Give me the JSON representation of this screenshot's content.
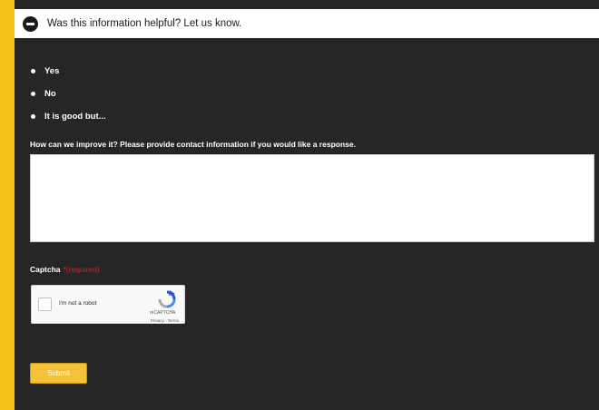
{
  "header": {
    "title": "Was this information helpful? Let us know."
  },
  "options": [
    {
      "label": "Yes"
    },
    {
      "label": "No"
    },
    {
      "label": "It is good but..."
    }
  ],
  "form": {
    "question": "How can we improve it? Please provide contact information if you would like a response.",
    "feedback_value": "",
    "captcha_label": "Captcha",
    "required_text": "*(required)",
    "recaptcha": {
      "checkbox_label": "I'm not a robot",
      "brand": "reCAPTCHA",
      "links": "Privacy - Terms"
    },
    "submit_label": "Submit"
  },
  "colors": {
    "accent": "#f5c21b",
    "panel": "#262626",
    "required": "#e02020"
  }
}
